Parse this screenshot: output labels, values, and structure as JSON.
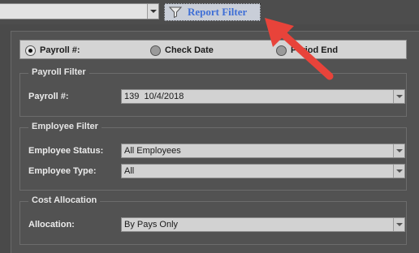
{
  "toolbar": {
    "report_filter_label": "Report Filter"
  },
  "radio": {
    "payroll_label": "Payroll #:",
    "check_date_label": "Check Date",
    "period_end_label": "Period End"
  },
  "payroll_filter": {
    "title": "Payroll Filter",
    "payroll_label": "Payroll #:",
    "payroll_value": "139  10/4/2018"
  },
  "employee_filter": {
    "title": "Employee Filter",
    "status_label": "Employee Status:",
    "status_value": "All Employees",
    "type_label": "Employee Type:",
    "type_value": "All"
  },
  "cost_allocation": {
    "title": "Cost Allocation",
    "allocation_label": "Allocation:",
    "allocation_value": "By Pays Only"
  },
  "colors": {
    "annotation_arrow": "#e8433a",
    "report_filter_text": "#3f6fd6"
  }
}
